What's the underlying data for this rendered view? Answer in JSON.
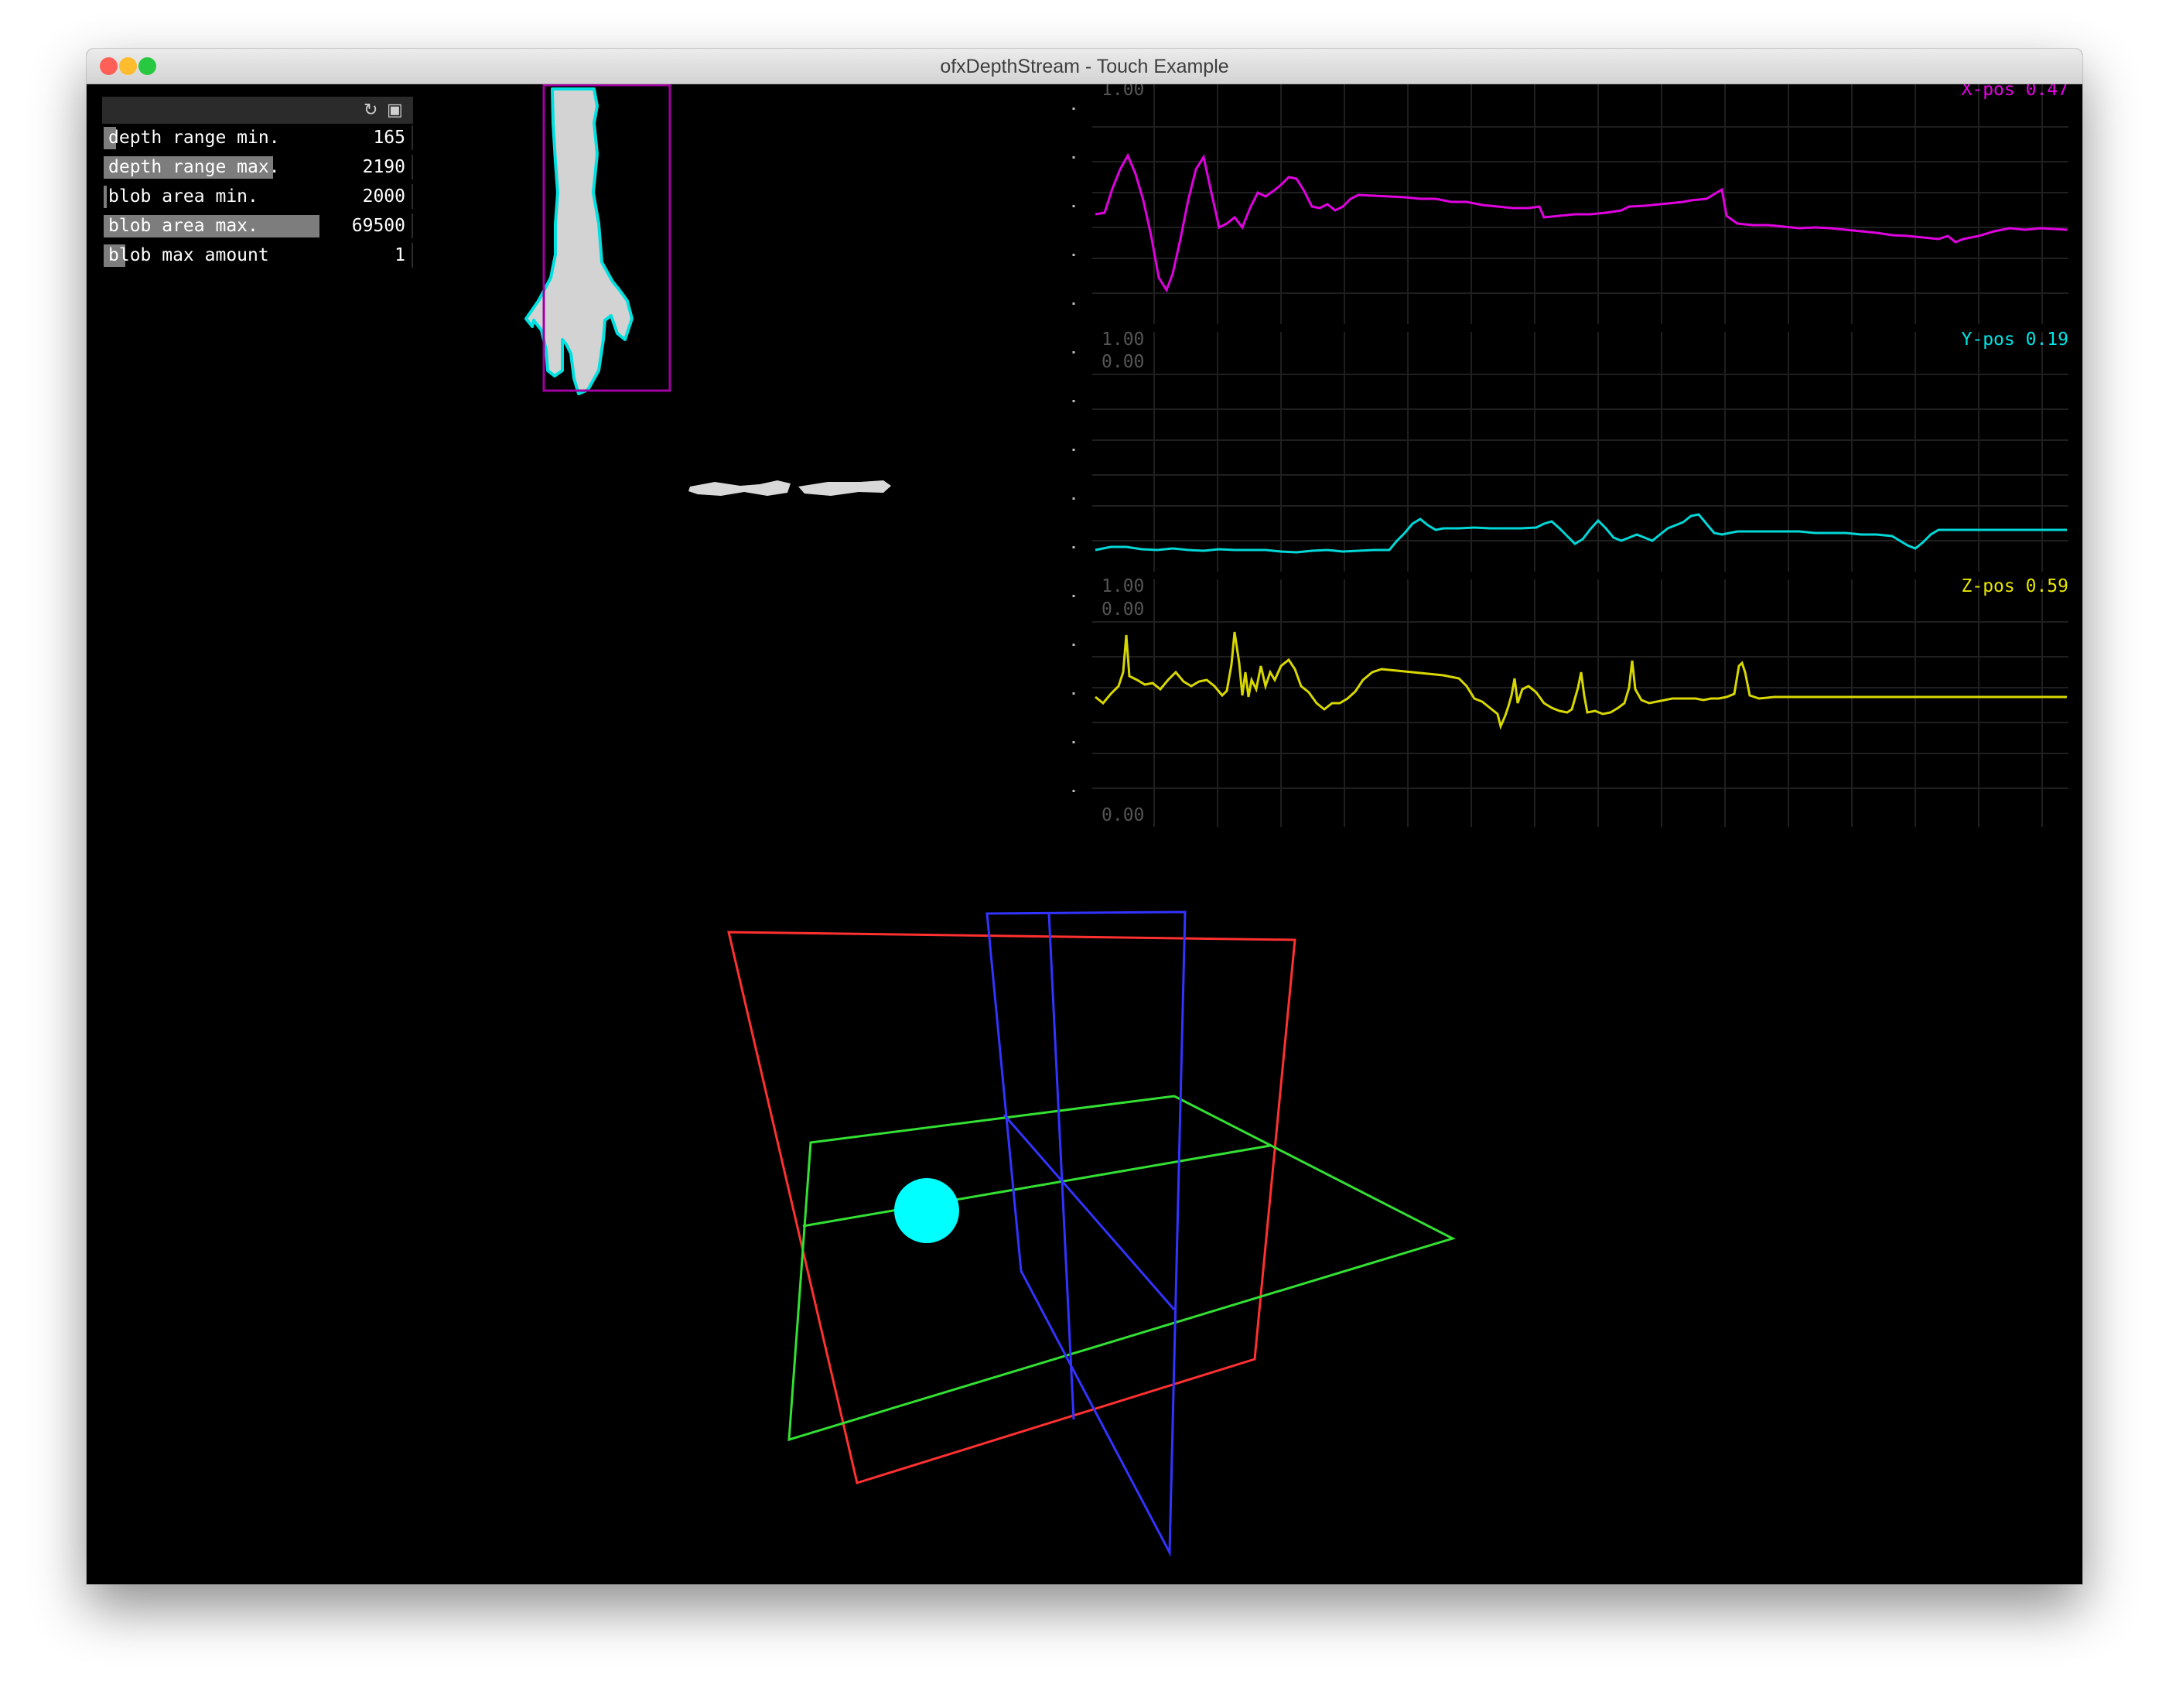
{
  "window": {
    "title": "ofxDepthStream - Touch Example"
  },
  "traffic_lights": {
    "close": "#fe5f57",
    "minimize": "#febc2e",
    "zoom": "#28c840"
  },
  "gui": {
    "icons": [
      "refresh-icon",
      "save-icon"
    ],
    "params": [
      {
        "label": "depth range min.",
        "value": "165",
        "level": 0.04
      },
      {
        "label": "depth range max.",
        "value": "2190",
        "level": 0.55
      },
      {
        "label": "blob area min.",
        "value": "2000",
        "level": 0.01
      },
      {
        "label": "blob area max.",
        "value": "69500",
        "level": 0.7
      },
      {
        "label": "blob max amount",
        "value": "1",
        "level": 0.07
      }
    ]
  },
  "graphs": [
    {
      "label": "X-pos 0.47",
      "color": "#e600e6",
      "max_label": "1.00",
      "min_label": "0.00"
    },
    {
      "label": "Y-pos 0.19",
      "color": "#00e6e6",
      "max_label": "1.00",
      "min_label": "0.00"
    },
    {
      "label": "Z-pos 0.59",
      "color": "#e6e600",
      "max_label": "1.00",
      "min_label": "0.00"
    }
  ],
  "scene": {
    "plane_colors": {
      "xy": "#ff3030",
      "xz": "#30e030",
      "yz": "#3030ff"
    },
    "marker_color": "#00ffff"
  }
}
